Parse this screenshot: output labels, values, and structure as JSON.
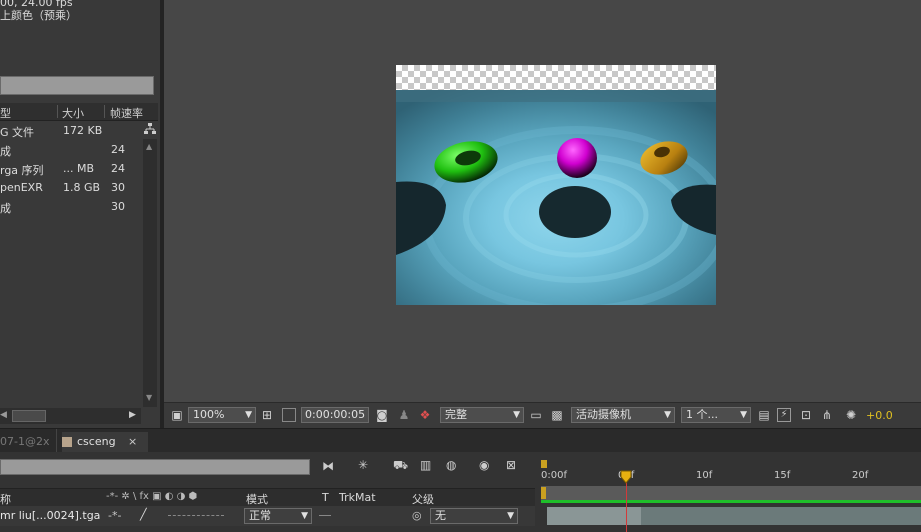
{
  "project": {
    "info_line1": "00, 24.00 fps",
    "info_line2": "上颜色（预乘）",
    "columns": {
      "type": "型",
      "size": "大小",
      "fps": "帧速率"
    },
    "items": [
      {
        "type": "G 文件",
        "size": "172 KB",
        "fps": ""
      },
      {
        "type": "成",
        "size": "",
        "fps": "24"
      },
      {
        "type": "rga 序列",
        "size": "... MB",
        "fps": "24"
      },
      {
        "type": "penEXR",
        "size": "1.8 GB",
        "fps": "30"
      },
      {
        "type": "成",
        "size": "",
        "fps": "30"
      }
    ]
  },
  "viewer_toolbar": {
    "zoom": "100%",
    "timecode": "0:00:00:05",
    "resolution": "完整",
    "camera": "活动摄像机",
    "views": "1 个...",
    "exposure": "+0.0",
    "exposure_color": "#e0c020"
  },
  "timeline_tabs": {
    "prev_tab": "07-1@2x",
    "comp_tab": "csceng",
    "close_glyph": "×"
  },
  "timeline": {
    "columns": {
      "name": "称",
      "switches": "-*- ✲ \\ fx ▣ ◐ ◑ ⬢",
      "mode": "模式",
      "t": "T",
      "trkmat": "TrkMat",
      "parent": "父级"
    },
    "layer": {
      "name": "mr liu[...0024].tga",
      "mode": "正常",
      "parent": "无"
    },
    "ruler_labels": [
      "0:00f",
      "05f",
      "10f",
      "15f",
      "20f"
    ],
    "cti_color": "#d23a3a"
  }
}
